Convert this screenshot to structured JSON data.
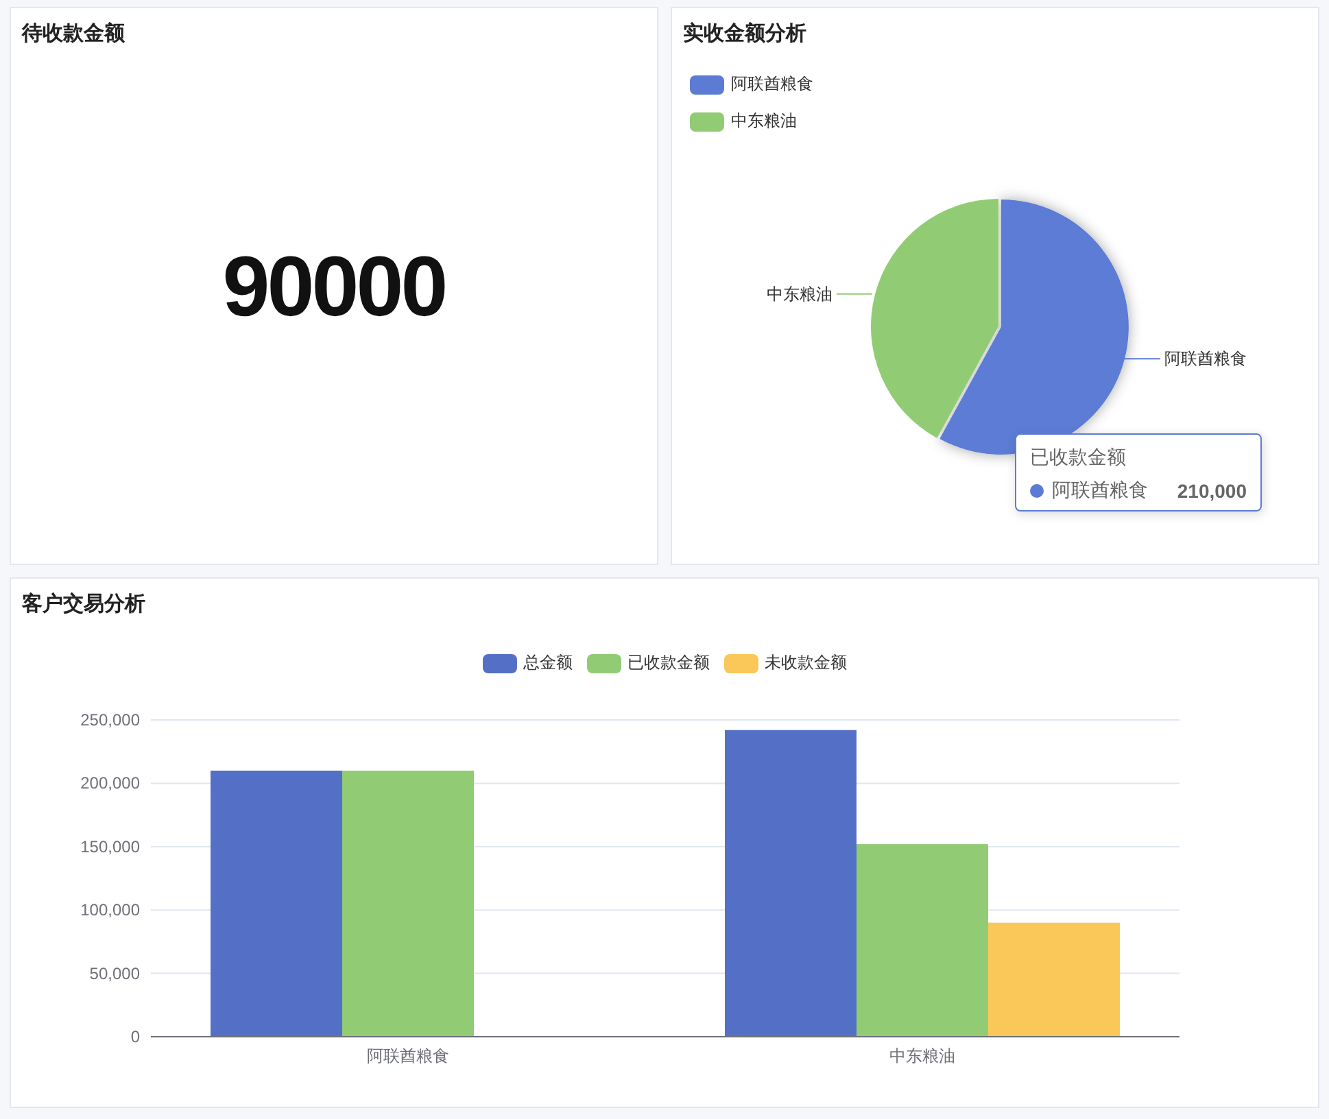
{
  "pending_card": {
    "title": "待收款金额",
    "value": "90000"
  },
  "pie_card": {
    "title": "实收金额分析",
    "legend": [
      {
        "label": "阿联酋粮食",
        "color": "#5b7bd5"
      },
      {
        "label": "中东粮油",
        "color": "#91cc75"
      }
    ],
    "chart_data": {
      "type": "pie",
      "categories": [
        "阿联酋粮食",
        "中东粮油"
      ],
      "series": [
        {
          "values": [
            58,
            42
          ]
        }
      ]
    },
    "slices": [
      {
        "emphasized": true
      },
      {
        "emphasized": false
      }
    ],
    "tooltip": {
      "title": "已收款金额",
      "name": "阿联酋粮食",
      "value": "210,000",
      "color": "#5b7bd5"
    }
  },
  "bar_card": {
    "title": "客户交易分析",
    "chart_data": {
      "type": "bar",
      "categories": [
        "阿联酋粮食",
        "中东粮油"
      ],
      "series": [
        {
          "name": "总金额",
          "color": "#5470c6",
          "values": [
            210000,
            242000
          ]
        },
        {
          "name": "已收款金额",
          "color": "#91cc75",
          "values": [
            210000,
            152000
          ]
        },
        {
          "name": "未收款金额",
          "color": "#fac858",
          "values": [
            0,
            90000
          ]
        }
      ],
      "ylim": [
        0,
        250000
      ],
      "grid": true,
      "yticks": [
        {
          "value": 0,
          "label": "0"
        },
        {
          "value": 50000,
          "label": "50,000"
        },
        {
          "value": 100000,
          "label": "100,000"
        },
        {
          "value": 150000,
          "label": "150,000"
        },
        {
          "value": 200000,
          "label": "200,000"
        },
        {
          "value": 250000,
          "label": "250,000"
        }
      ]
    }
  }
}
